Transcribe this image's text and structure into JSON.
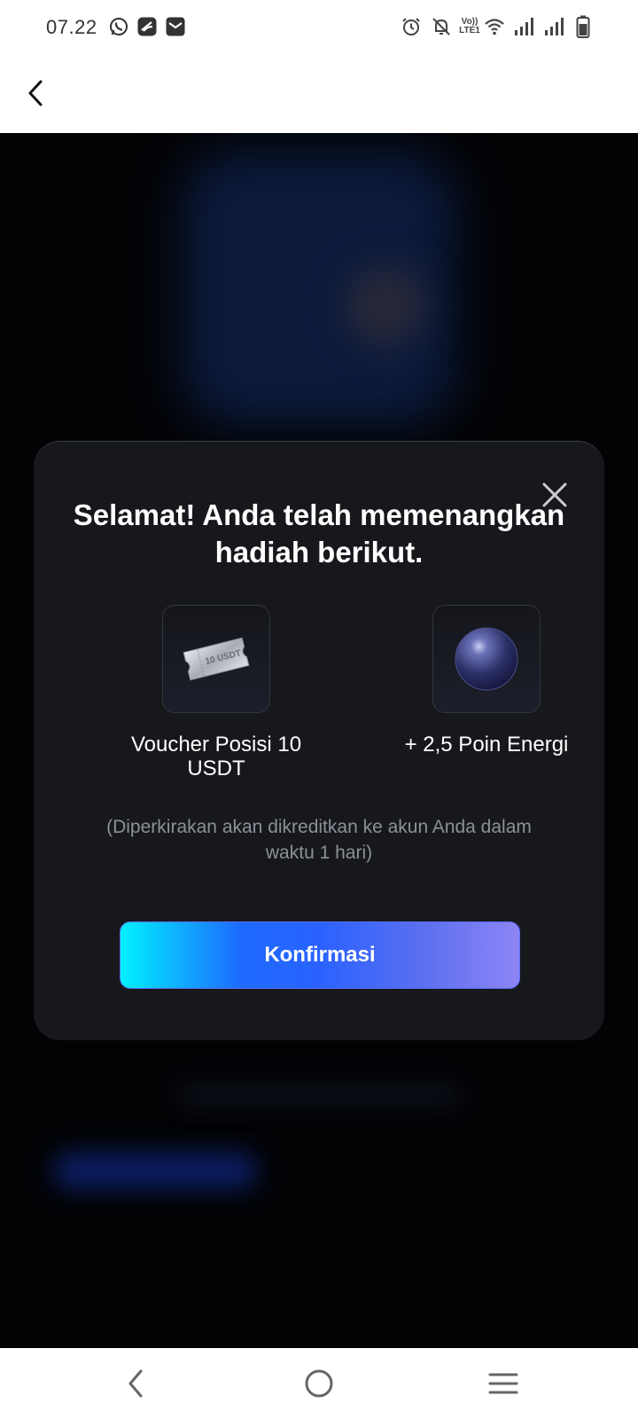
{
  "status_bar": {
    "time": "07.22",
    "icons": [
      "whatsapp-icon",
      "app-icon",
      "mail-icon",
      "alarm-icon",
      "mute-icon",
      "volte-icon",
      "wifi-icon",
      "signal-icon",
      "signal-icon",
      "battery-icon"
    ],
    "volte_text_top": "Vo))",
    "volte_text_bottom": "LTE1"
  },
  "app_bar": {
    "back_icon": "chevron-left-icon"
  },
  "dialog": {
    "title": "Selamat! Anda telah memenangkan hadiah berikut.",
    "rewards": [
      {
        "icon": "voucher-ticket-icon",
        "ticket_text": "10 USDT",
        "label": "Voucher Posisi 10 USDT"
      },
      {
        "icon": "energy-orb-icon",
        "label": "+ 2,5 Poin Energi"
      }
    ],
    "note": "(Diperkirakan akan dikreditkan ke akun Anda dalam waktu 1 hari)",
    "confirm_label": "Konfirmasi",
    "colors": {
      "background": "#17181c",
      "button_gradient_start": "#00f0ff",
      "button_gradient_end": "#8c85f5"
    }
  },
  "nav_bar": {
    "icons": [
      "back-nav-icon",
      "home-circle-icon",
      "menu-icon"
    ]
  }
}
